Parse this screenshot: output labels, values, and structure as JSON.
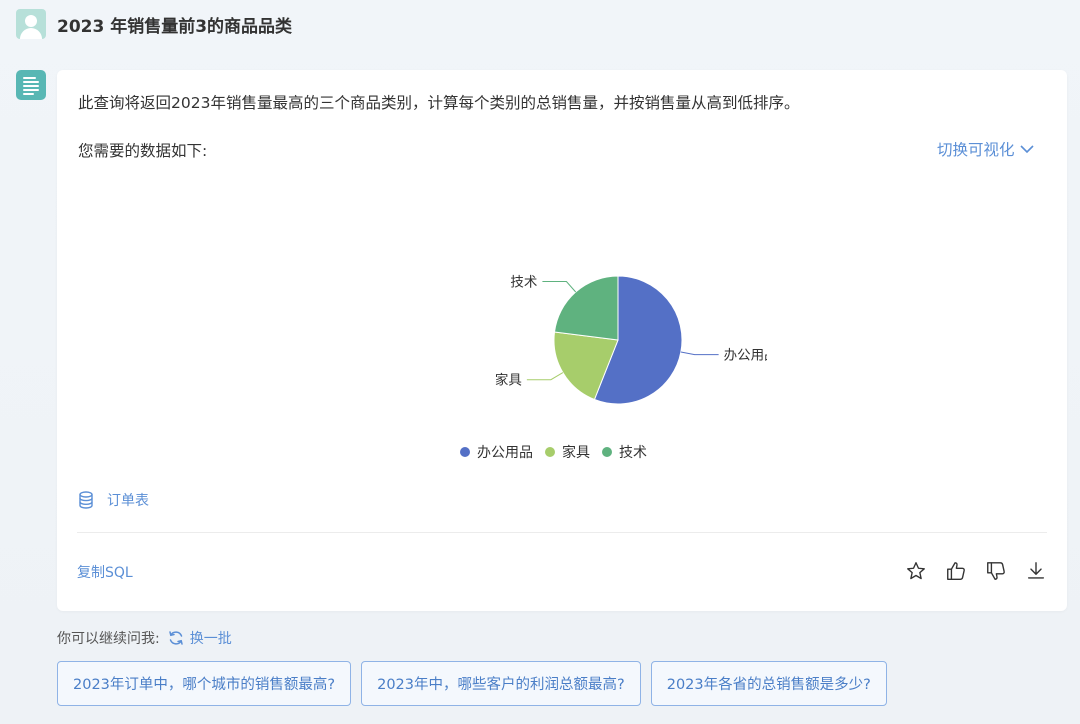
{
  "user": {
    "question": "2023 年销售量前3的商品品类"
  },
  "answer": {
    "description": "此查询将返回2023年销售量最高的三个商品类别，计算每个类别的总销售量，并按销售量从高到低排序。",
    "data_intro": "您需要的数据如下:",
    "switch_label": "切换可视化",
    "source_table": "订单表",
    "copy_sql": "复制SQL"
  },
  "chart_data": {
    "type": "pie",
    "categories": [
      "办公用品",
      "家具",
      "技术"
    ],
    "values": [
      56,
      21,
      23
    ],
    "colors": [
      "#5470c6",
      "#a7cd6b",
      "#5fb27f"
    ],
    "legend_position": "bottom"
  },
  "followup": {
    "label": "你可以继续问我:",
    "refresh": "换一批",
    "suggestions": [
      "2023年订单中，哪个城市的销售额最高?",
      "2023年中，哪些客户的利润总额最高?",
      "2023年各省的总销售额是多少?"
    ]
  },
  "icons": {
    "user_avatar": "user-avatar-icon",
    "bot": "document-lines-icon",
    "switch": "chevron-down-icon",
    "source": "database-icon",
    "actions": [
      "star-icon",
      "thumbs-up-icon",
      "thumbs-down-icon",
      "download-icon"
    ],
    "refresh": "refresh-icon"
  }
}
